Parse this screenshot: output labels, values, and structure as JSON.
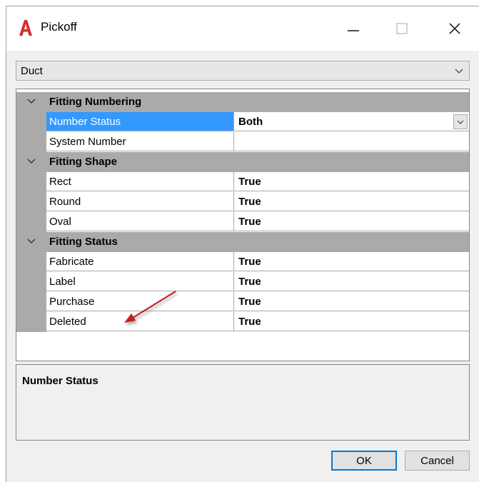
{
  "window": {
    "title": "Pickoff",
    "logo_letter": "A",
    "brand_color": "#d0312d",
    "controls": [
      "minimize-icon",
      "maximize-icon",
      "close-icon"
    ]
  },
  "object_type": {
    "selected": "Duct"
  },
  "grid": {
    "categories": [
      {
        "label": "Fitting Numbering",
        "properties": [
          {
            "name": "Number Status",
            "value": "Both",
            "selected": true,
            "has_dropdown": true
          },
          {
            "name": "System Number",
            "value": ""
          }
        ]
      },
      {
        "label": "Fitting Shape",
        "properties": [
          {
            "name": "Rect",
            "value": "True"
          },
          {
            "name": "Round",
            "value": "True"
          },
          {
            "name": "Oval",
            "value": "True"
          }
        ]
      },
      {
        "label": "Fitting Status",
        "properties": [
          {
            "name": "Fabricate",
            "value": "True"
          },
          {
            "name": "Label",
            "value": "True"
          },
          {
            "name": "Purchase",
            "value": "True"
          },
          {
            "name": "Deleted",
            "value": "True"
          }
        ]
      }
    ],
    "selection_color": "#3399ff",
    "category_color": "#aaaaaa"
  },
  "description": {
    "title": "Number Status"
  },
  "buttons": {
    "ok": "OK",
    "cancel": "Cancel"
  },
  "annotation": {
    "arrow_color": "#c0201e",
    "points_to": "Deleted"
  }
}
